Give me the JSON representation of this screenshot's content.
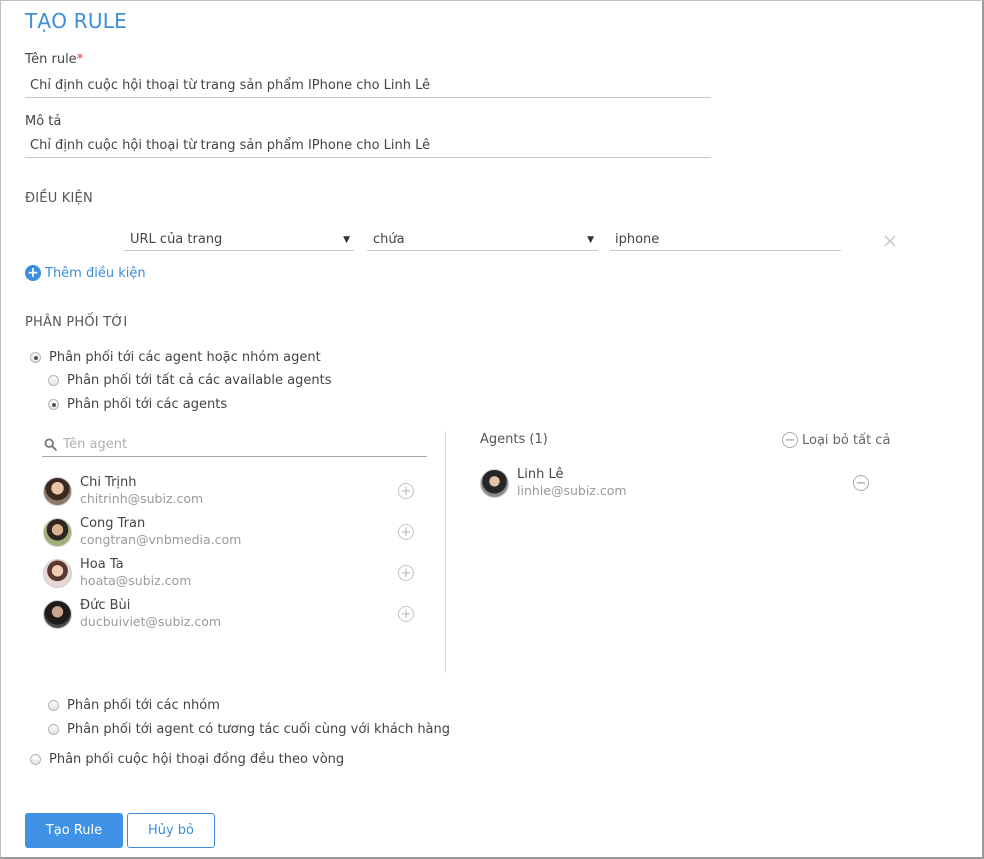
{
  "page_title": "TẠO RULE",
  "rule_name": {
    "label": "Tên rule",
    "required_mark": "*",
    "value": "Chỉ định cuộc hội thoại từ trang sản phẩm IPhone cho Linh Lê"
  },
  "description": {
    "label": "Mô tả",
    "value": "Chỉ định cuộc hội thoại từ trang sản phẩm IPhone cho Linh Lê"
  },
  "conditions": {
    "heading": "ĐIỀU KIỆN",
    "rows": [
      {
        "field": "URL của trang",
        "operator": "chứa",
        "value": "iphone"
      }
    ],
    "add_label": "Thêm điều kiện"
  },
  "distribution": {
    "heading": "PHÂN PHỐI TỚI",
    "option_agents_or_groups": "Phân phối tới các agent hoặc nhóm agent",
    "option_all_available": "Phân phối tới tất cả các available agents",
    "option_agents": "Phân phối tới các agents",
    "option_groups": "Phân phối tới các nhóm",
    "option_last_agent": "Phân phối tới agent có tương tác cuối cùng với khách hàng",
    "option_round_robin": "Phân phối cuộc hội thoại đồng đều theo vòng"
  },
  "agent_search": {
    "placeholder": "Tên agent"
  },
  "available_agents": [
    {
      "name": "Chi Trịnh",
      "email": "chitrinh@subiz.com"
    },
    {
      "name": "Cong Tran",
      "email": "congtran@vnbmedia.com"
    },
    {
      "name": "Hoa Ta",
      "email": "hoata@subiz.com"
    },
    {
      "name": "Đức Bùi",
      "email": "ducbuiviet@subiz.com"
    }
  ],
  "selected_agents": {
    "heading": "Agents (1)",
    "remove_all_label": "Loại bỏ tất cả",
    "items": [
      {
        "name": "Linh Lê",
        "email": "linhle@subiz.com"
      }
    ]
  },
  "buttons": {
    "create": "Tạo Rule",
    "cancel": "Hủy bỏ"
  },
  "colors": {
    "accent": "#3b8de0",
    "primary_button": "#3f92e6"
  },
  "icons": {
    "search": "search-icon",
    "add": "plus-circle-icon",
    "remove": "minus-circle-icon",
    "close": "close-icon",
    "dropdown": "caret-down-icon"
  }
}
